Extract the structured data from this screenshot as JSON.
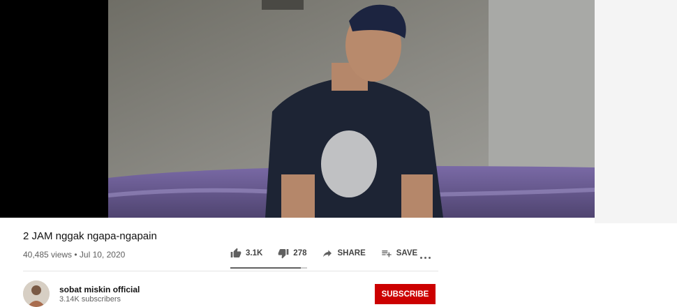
{
  "video": {
    "title": "2 JAM nggak ngapa-ngapain",
    "meta": "40,485 views • Jul 10, 2020",
    "rating_fraction": 0.92
  },
  "actions": {
    "like_count": "3.1K",
    "dislike_count": "278",
    "share_label": "SHARE",
    "save_label": "SAVE"
  },
  "channel": {
    "name": "sobat miskin official",
    "subscribers": "3.14K subscribers"
  },
  "subscribe_button": {
    "label": "SUBSCRIBE"
  },
  "colors": {
    "subscribe_bg": "#cc0000",
    "text_primary": "#111111",
    "text_secondary": "#606060"
  },
  "icons": [
    "thumb-up-icon",
    "thumb-down-icon",
    "share-icon",
    "playlist-add-icon",
    "more-icon"
  ]
}
